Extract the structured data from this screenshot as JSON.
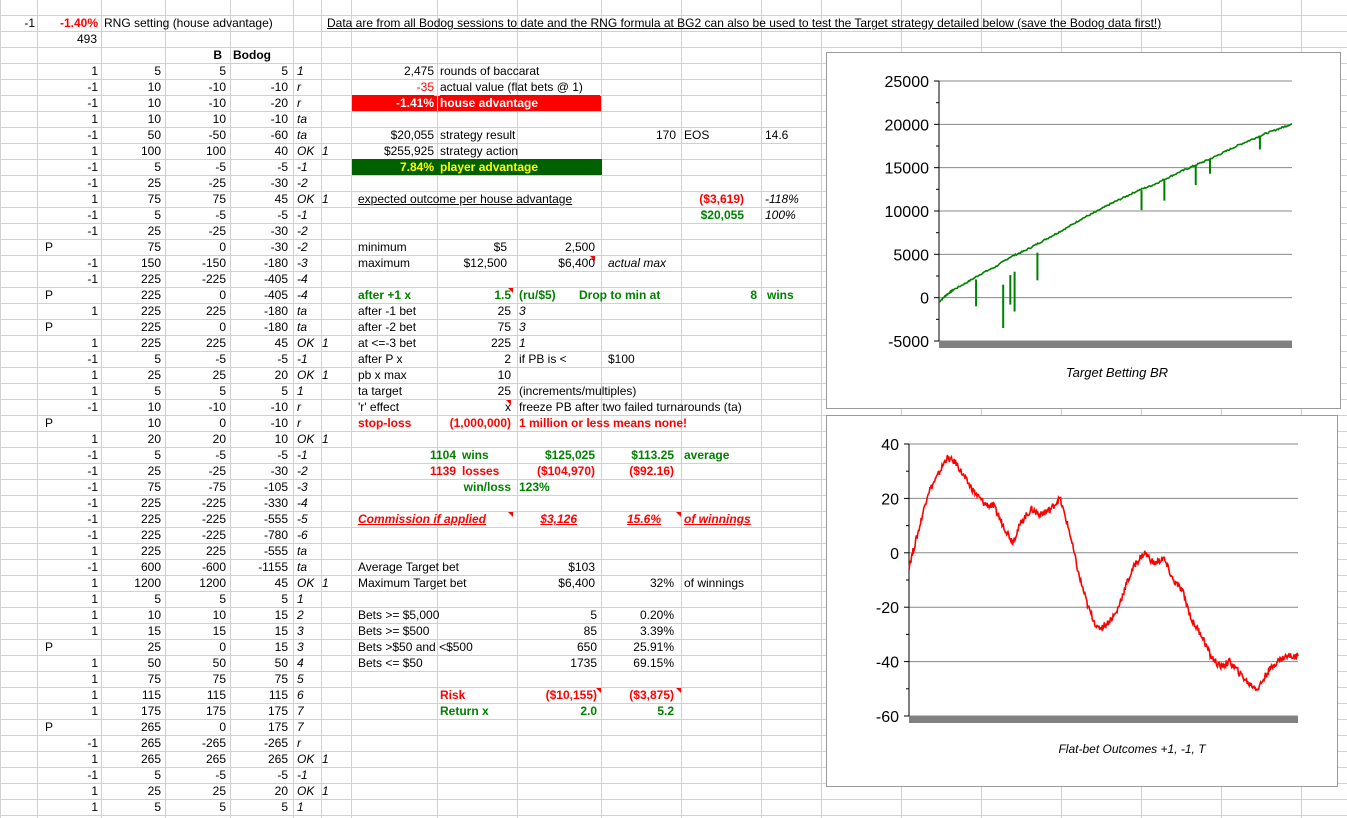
{
  "top": {
    "a1": "-1",
    "b1": "-1.40%",
    "c1": "RNG setting (house advantage)",
    "note": "Data are from all Bodog sessions to date and the RNG formula at BG2 can also be used to test the Target strategy detailed below (save the Bodog data first!)",
    "b2": "493",
    "hdr_b": "B",
    "hdr_bodog": "Bodog"
  },
  "rows": [
    [
      "",
      "1",
      "5",
      "5",
      "5",
      "1",
      ""
    ],
    [
      "",
      "-1",
      "10",
      "-10",
      "-10",
      "r",
      ""
    ],
    [
      "",
      "-1",
      "10",
      "-10",
      "-20",
      "r",
      ""
    ],
    [
      "",
      "1",
      "10",
      "10",
      "-10",
      "ta",
      ""
    ],
    [
      "",
      "-1",
      "50",
      "-50",
      "-60",
      "ta",
      ""
    ],
    [
      "",
      "1",
      "100",
      "100",
      "40",
      "OK",
      "1"
    ],
    [
      "",
      "-1",
      "5",
      "-5",
      "-5",
      "-1",
      ""
    ],
    [
      "",
      "-1",
      "25",
      "-25",
      "-30",
      "-2",
      ""
    ],
    [
      "",
      "1",
      "75",
      "75",
      "45",
      "OK",
      "1"
    ],
    [
      "",
      "-1",
      "5",
      "-5",
      "-5",
      "-1",
      ""
    ],
    [
      "",
      "-1",
      "25",
      "-25",
      "-30",
      "-2",
      ""
    ],
    [
      "P",
      "",
      "75",
      "0",
      "-30",
      "-2",
      ""
    ],
    [
      "",
      "-1",
      "150",
      "-150",
      "-180",
      "-3",
      ""
    ],
    [
      "",
      "-1",
      "225",
      "-225",
      "-405",
      "-4",
      ""
    ],
    [
      "P",
      "",
      "225",
      "0",
      "-405",
      "-4",
      ""
    ],
    [
      "",
      "1",
      "225",
      "225",
      "-180",
      "ta",
      ""
    ],
    [
      "P",
      "",
      "225",
      "0",
      "-180",
      "ta",
      ""
    ],
    [
      "",
      "1",
      "225",
      "225",
      "45",
      "OK",
      "1"
    ],
    [
      "",
      "-1",
      "5",
      "-5",
      "-5",
      "-1",
      ""
    ],
    [
      "",
      "1",
      "25",
      "25",
      "20",
      "OK",
      "1"
    ],
    [
      "",
      "1",
      "5",
      "5",
      "5",
      "1",
      ""
    ],
    [
      "",
      "-1",
      "10",
      "-10",
      "-10",
      "r",
      ""
    ],
    [
      "P",
      "",
      "10",
      "0",
      "-10",
      "r",
      ""
    ],
    [
      "",
      "1",
      "20",
      "20",
      "10",
      "OK",
      "1"
    ],
    [
      "",
      "-1",
      "5",
      "-5",
      "-5",
      "-1",
      ""
    ],
    [
      "",
      "-1",
      "25",
      "-25",
      "-30",
      "-2",
      ""
    ],
    [
      "",
      "-1",
      "75",
      "-75",
      "-105",
      "-3",
      ""
    ],
    [
      "",
      "-1",
      "225",
      "-225",
      "-330",
      "-4",
      ""
    ],
    [
      "",
      "-1",
      "225",
      "-225",
      "-555",
      "-5",
      ""
    ],
    [
      "",
      "-1",
      "225",
      "-225",
      "-780",
      "-6",
      ""
    ],
    [
      "",
      "1",
      "225",
      "225",
      "-555",
      "ta",
      ""
    ],
    [
      "",
      "-1",
      "600",
      "-600",
      "-1155",
      "ta",
      ""
    ],
    [
      "",
      "1",
      "1200",
      "1200",
      "45",
      "OK",
      "1"
    ],
    [
      "",
      "1",
      "5",
      "5",
      "5",
      "1",
      ""
    ],
    [
      "",
      "1",
      "10",
      "10",
      "15",
      "2",
      ""
    ],
    [
      "",
      "1",
      "15",
      "15",
      "15",
      "3",
      ""
    ],
    [
      "P",
      "",
      "25",
      "0",
      "15",
      "3",
      ""
    ],
    [
      "",
      "1",
      "50",
      "50",
      "50",
      "4",
      ""
    ],
    [
      "",
      "1",
      "75",
      "75",
      "75",
      "5",
      ""
    ],
    [
      "",
      "1",
      "115",
      "115",
      "115",
      "6",
      ""
    ],
    [
      "",
      "1",
      "175",
      "175",
      "175",
      "7",
      ""
    ],
    [
      "P",
      "",
      "265",
      "0",
      "175",
      "7",
      ""
    ],
    [
      "",
      "-1",
      "265",
      "-265",
      "-265",
      "r",
      ""
    ],
    [
      "",
      "1",
      "265",
      "265",
      "265",
      "OK",
      "1"
    ],
    [
      "",
      "-1",
      "5",
      "-5",
      "-5",
      "-1",
      ""
    ],
    [
      "",
      "1",
      "25",
      "25",
      "20",
      "OK",
      "1"
    ],
    [
      "",
      "1",
      "5",
      "5",
      "5",
      "1",
      ""
    ]
  ],
  "stats": {
    "rounds_val": "2,475",
    "rounds_lbl": "rounds of baccarat",
    "actual_val": "-35",
    "actual_lbl": "actual value (flat bets @ 1)",
    "ha_val": "-1.41%",
    "ha_lbl": "house advantage",
    "sr_val": "$20,055",
    "sr_lbl": "strategy result",
    "eos_val": "170",
    "eos_lbl": "EOS",
    "eos2": "14.6",
    "sa_val": "$255,925",
    "sa_lbl": "strategy action",
    "pa_val": "7.84%",
    "pa_lbl": "player advantage",
    "exp_lbl": "expected outcome per house advantage",
    "exp_val": "($3,619)",
    "exp_pct": "-118%",
    "res_val": "$20,055",
    "res_pct": "100%",
    "min_lbl": "minimum",
    "min_val": "$5",
    "min_val2": "2,500",
    "max_lbl": "maximum",
    "max_val": "$12,500",
    "max_val2": "$6,400",
    "max_note": "actual max",
    "after1_lbl": "after +1 x",
    "after1_val": "1.5",
    "after1_unit": "(ru/$5)",
    "drop_lbl": "Drop to min at",
    "drop_val": "8",
    "drop_unit": "wins",
    "am1_lbl": "after -1 bet",
    "am1_val": "25",
    "am1_n": "3",
    "am2_lbl": "after -2 bet",
    "am2_val": "75",
    "am2_n": "3",
    "am3_lbl": "at <=-3 bet",
    "am3_val": "225",
    "am3_n": "1",
    "ap_lbl": "after P x",
    "ap_val": "2",
    "ap_note": "if PB is <",
    "ap_amt": "$100",
    "pb_lbl": "pb x max",
    "pb_val": "10",
    "tt_lbl": "ta target",
    "tt_val": "25",
    "tt_note": "(increments/multiples)",
    "re_lbl": "'r' effect",
    "re_val": "x",
    "re_note": "freeze PB after two failed turnarounds (ta)",
    "sl_lbl": "stop-loss",
    "sl_val": "(1,000,000)",
    "sl_note": "1 million or less means none!",
    "wins_n": "1104",
    "wins_lbl": "wins",
    "wins_amt": "$125,025",
    "wins_avg": "$113.25",
    "avg_lbl": "average",
    "loss_n": "1139",
    "loss_lbl": "losses",
    "loss_amt": "($104,970)",
    "loss_avg": "($92.16)",
    "wl_lbl": "win/loss",
    "wl_val": "123%",
    "com_lbl": "Commission if applied",
    "com_val": "$3,126",
    "com_pct": "15.6%",
    "com_of": "of winnings",
    "avgt_lbl": "Average Target bet",
    "avgt_val": "$103",
    "maxt_lbl": "Maximum Target bet",
    "maxt_val": "$6,400",
    "maxt_pct": "32%",
    "maxt_of": "of winnings",
    "b5k_lbl": "Bets >= $5,000",
    "b5k_n": "5",
    "b5k_p": "0.20%",
    "b500_lbl": "Bets >= $500",
    "b500_n": "85",
    "b500_p": "3.39%",
    "b50_lbl": "Bets >$50 and <$500",
    "b50_n": "650",
    "b50_p": "25.91%",
    "ble_lbl": "Bets <= $50",
    "ble_n": "1735",
    "ble_p": "69.15%",
    "risk_lbl": "Risk",
    "risk_v1": "($10,155)",
    "risk_v2": "($3,875)",
    "ret_lbl": "Return x",
    "ret_v1": "2.0",
    "ret_v2": "5.2"
  },
  "chart_data": [
    {
      "type": "line",
      "title": "Target Betting BR",
      "color": "#008000",
      "ylim": [
        -5000,
        25000
      ],
      "yticks": [
        "25000",
        "20000",
        "15000",
        "10000",
        "5000",
        "0",
        "-5000"
      ],
      "x": [
        0,
        50,
        100,
        200,
        300,
        400,
        500,
        600,
        700,
        800,
        900,
        1000,
        1100,
        1200,
        1300,
        1400,
        1500,
        1600,
        1700,
        1800,
        1900,
        2000,
        2100,
        2200,
        2300,
        2400,
        2475
      ],
      "values": [
        -500,
        300,
        900,
        1800,
        2800,
        3600,
        4700,
        5400,
        6300,
        7200,
        8100,
        9100,
        9900,
        10800,
        11600,
        12400,
        13000,
        13800,
        14600,
        15300,
        16000,
        16800,
        17600,
        18300,
        19000,
        19600,
        20055
      ]
    },
    {
      "type": "line",
      "title": "Flat-bet Outcomes +1, -1, T",
      "color": "#ff0000",
      "ylim": [
        -60,
        40
      ],
      "yticks": [
        "40",
        "20",
        "0",
        "-20",
        "-40",
        "-60"
      ],
      "x": [
        0,
        60,
        120,
        180,
        240,
        300,
        360,
        420,
        480,
        540,
        600,
        660,
        720,
        780,
        840,
        900,
        960,
        1020,
        1080,
        1140,
        1200,
        1260,
        1320,
        1380,
        1440,
        1500,
        1560,
        1620,
        1680,
        1740,
        1800,
        1860,
        1920,
        1980,
        2040,
        2100,
        2160,
        2220,
        2280,
        2340,
        2400,
        2475
      ],
      "values": [
        -5,
        8,
        22,
        28,
        35,
        33,
        27,
        22,
        18,
        17,
        10,
        4,
        12,
        16,
        14,
        16,
        20,
        8,
        -8,
        -20,
        -28,
        -26,
        -22,
        -12,
        -4,
        0,
        -4,
        -2,
        -10,
        -14,
        -25,
        -30,
        -38,
        -42,
        -40,
        -44,
        -48,
        -50,
        -44,
        -40,
        -38,
        -38
      ]
    }
  ]
}
